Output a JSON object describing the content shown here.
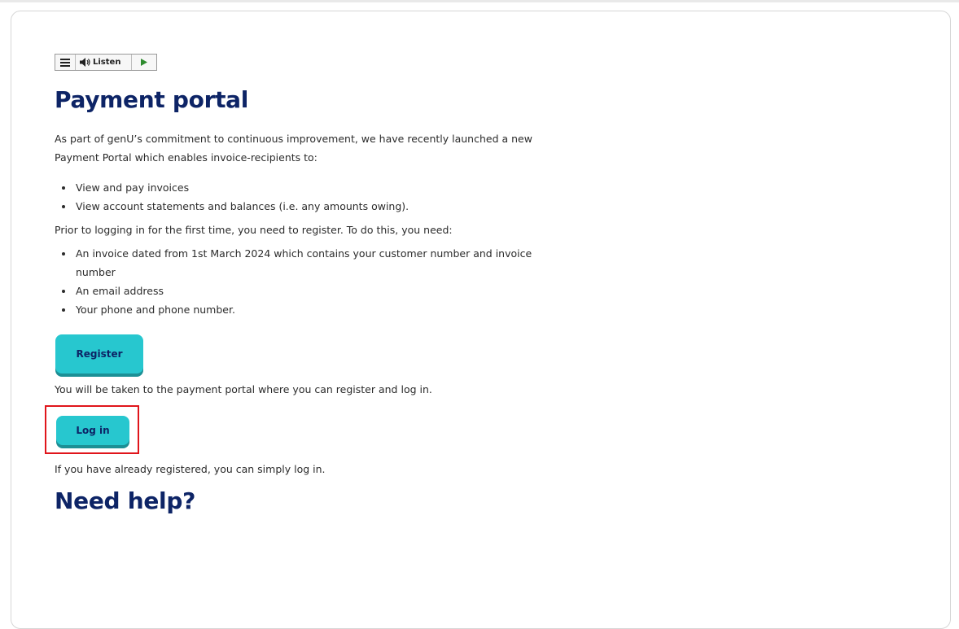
{
  "toolbar": {
    "menu_icon": "menu-icon",
    "speaker_icon": "speaker-icon",
    "listen_label": "Listen",
    "play_icon": "play-icon",
    "play_color": "#2e8b2e"
  },
  "page": {
    "title": "Payment portal",
    "intro": "As part of genU’s commitment to continuous improvement, we have recently launched a new Payment Portal which enables invoice-recipients to:",
    "features": [
      "View and pay invoices",
      "View account statements and balances (i.e. any amounts owing)."
    ],
    "prior_text": "Prior to logging in for the first time, you need to register. To do this, you need:",
    "requirements": [
      "An invoice dated from 1st March 2024 which contains your customer number and invoice number",
      "An email address",
      "Your phone and phone number."
    ],
    "register_label": "Register",
    "register_note": "You will be taken to the payment portal where you can register and log in.",
    "login_label": "Log in",
    "login_note": "If you have already registered, you can simply log in.",
    "help_heading": "Need help?"
  },
  "colors": {
    "heading": "#0d2466",
    "button": "#27c7cf",
    "button_shadow": "#1c8f95",
    "highlight": "#e0151b"
  }
}
